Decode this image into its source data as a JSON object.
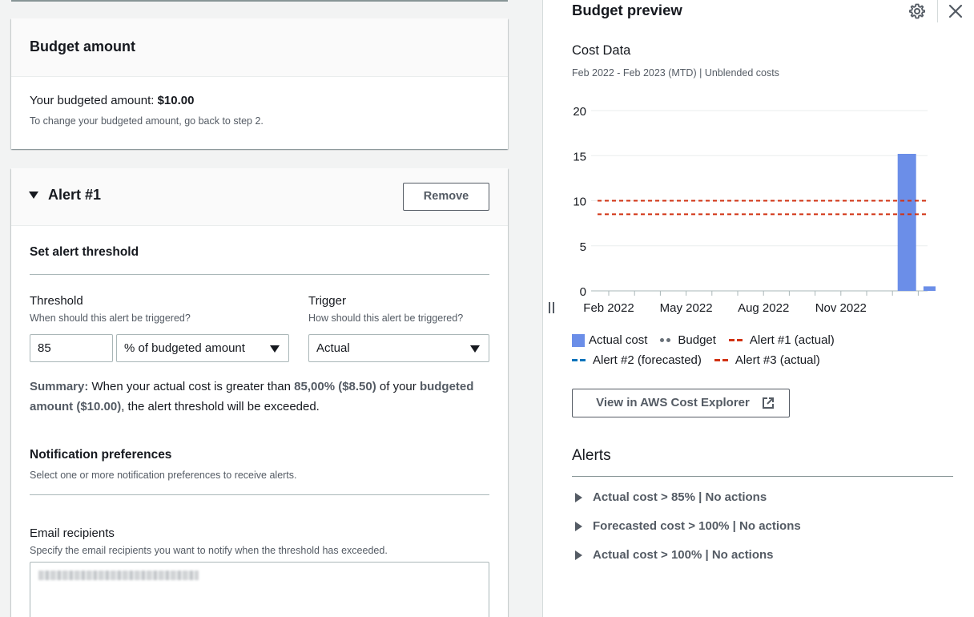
{
  "budget_card": {
    "title": "Budget amount",
    "budgeted_label": "Your budgeted amount: ",
    "budgeted_value": "$10.00",
    "hint": "To change your budgeted amount, go back to step 2."
  },
  "alert_card": {
    "title": "Alert #1",
    "remove_label": "Remove",
    "threshold_section": "Set alert threshold",
    "threshold_label": "Threshold",
    "threshold_hint": "When should this alert be triggered?",
    "threshold_value": "85",
    "threshold_unit": "% of budgeted amount",
    "trigger_label": "Trigger",
    "trigger_hint": "How should this alert be triggered?",
    "trigger_value": "Actual",
    "summary_label": "Summary:",
    "summary_text1": " When your actual cost is greater than ",
    "summary_pct": "85,00% ($8.50)",
    "summary_text2": " of your ",
    "summary_budget": "budgeted amount ($10.00)",
    "summary_text3": ", the alert threshold will be exceeded.",
    "notif_title": "Notification preferences",
    "notif_hint": "Select one or more notification preferences to receive alerts.",
    "email_label": "Email recipients",
    "email_hint": "Specify the email recipients you want to notify when the threshold has exceeded."
  },
  "panel": {
    "title": "Budget preview",
    "cost_title": "Cost Data",
    "cost_subtitle": "Feb 2022 - Feb 2023 (MTD) | Unblended costs",
    "legend": {
      "actual": "Actual cost",
      "budget": "Budget",
      "alert1": "Alert #1 (actual)",
      "alert2": "Alert #2 (forecasted)",
      "alert3": "Alert #3 (actual)"
    },
    "explorer_label": "View in AWS Cost Explorer",
    "alerts_title": "Alerts",
    "alerts": [
      "Actual cost > 85% | No actions",
      "Forecasted cost > 100% | No actions",
      "Actual cost > 100% | No actions"
    ]
  },
  "colors": {
    "bar": "#6b8ee8",
    "budget_dot": "#687078",
    "alert_red": "#d13212",
    "alert_blue": "#0073bb"
  },
  "chart_data": {
    "type": "bar",
    "x_ticks": [
      "Feb 2022",
      "May 2022",
      "Aug 2022",
      "Nov 2022"
    ],
    "categories": [
      "Feb 2022",
      "Mar 2022",
      "Apr 2022",
      "May 2022",
      "Jun 2022",
      "Jul 2022",
      "Aug 2022",
      "Sep 2022",
      "Oct 2022",
      "Nov 2022",
      "Dec 2022",
      "Jan 2023",
      "Feb 2023"
    ],
    "values": [
      0,
      0,
      0,
      0,
      0,
      0,
      0,
      0,
      0,
      0,
      0,
      15.2,
      0.5
    ],
    "y_ticks": [
      0,
      5,
      10,
      15,
      20
    ],
    "ylim": [
      0,
      20
    ],
    "reference_lines": [
      {
        "value": 10,
        "style": "dashed",
        "color": "#d13212"
      },
      {
        "value": 8.5,
        "style": "dashed",
        "color": "#d13212"
      }
    ],
    "grid": true
  }
}
